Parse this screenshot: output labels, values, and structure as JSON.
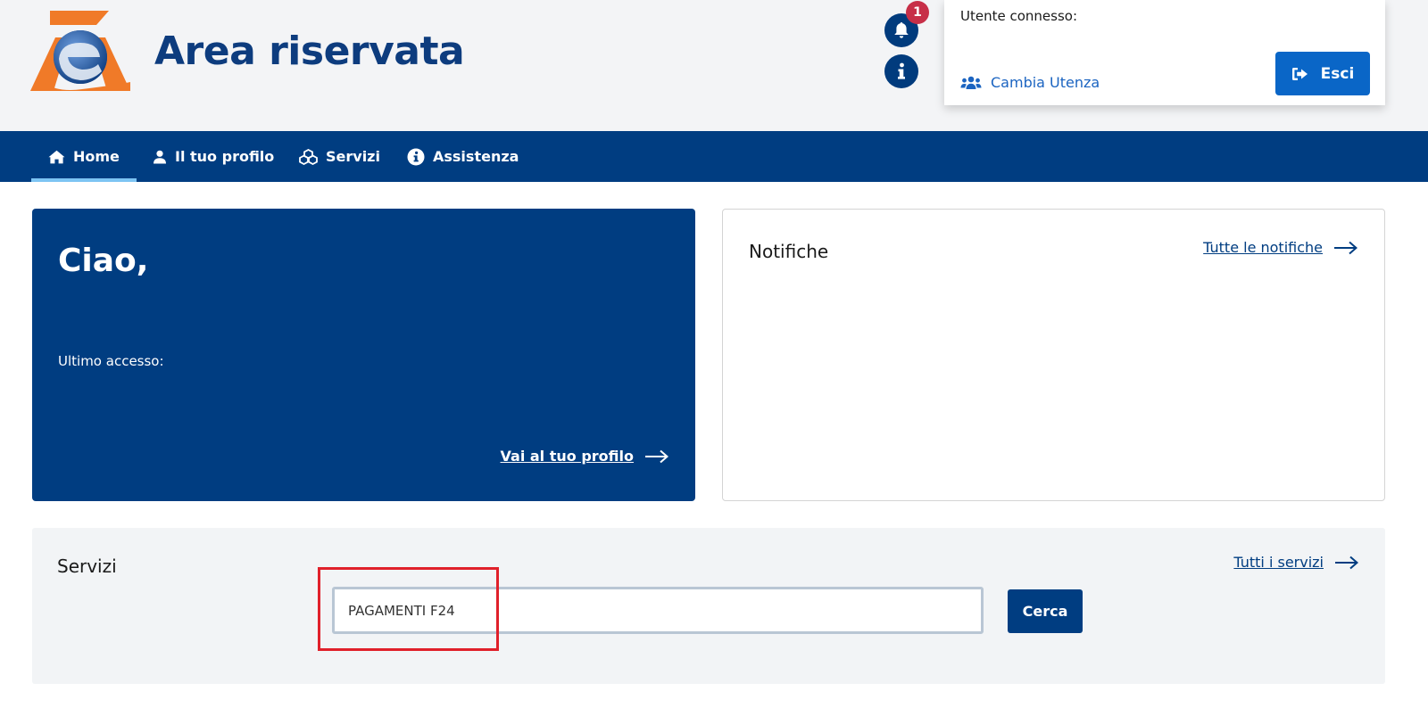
{
  "header": {
    "site_title": "Area riservata",
    "notification_count": "1"
  },
  "user_panel": {
    "user_label": "Utente connesso:",
    "switch_user_label": "Cambia Utenza",
    "logout_label": "Esci"
  },
  "nav": {
    "items": [
      {
        "label": "Home",
        "icon": "home-icon",
        "active": true
      },
      {
        "label": "Il tuo profilo",
        "icon": "user-icon",
        "active": false
      },
      {
        "label": "Servizi",
        "icon": "services-icon",
        "active": false
      },
      {
        "label": "Assistenza",
        "icon": "info-icon",
        "active": false
      }
    ]
  },
  "hello_card": {
    "title": "Ciao,",
    "last_access_label": "Ultimo accesso:",
    "profile_link": "Vai al tuo profilo"
  },
  "notifications": {
    "title": "Notifiche",
    "all_link": "Tutte le notifiche"
  },
  "services": {
    "title": "Servizi",
    "all_link": "Tutti i servizi",
    "search_value": "PAGAMENTI F24",
    "search_button": "Cerca"
  },
  "colors": {
    "primary": "#003d81",
    "accent_blue": "#0a66c7",
    "badge": "#c72f48",
    "highlight": "#e0202a",
    "logo_orange": "#f07a28"
  }
}
